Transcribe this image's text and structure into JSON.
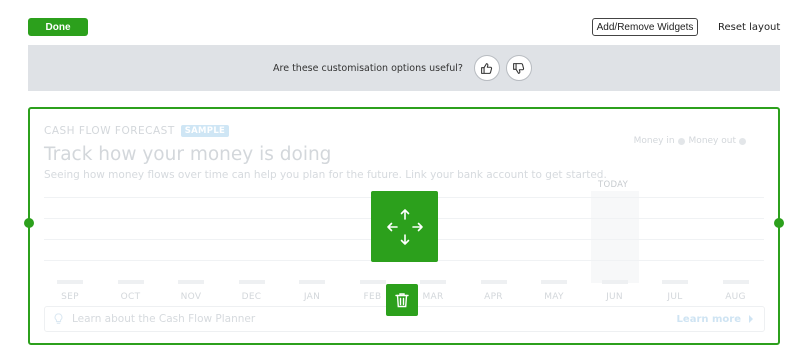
{
  "toolbar": {
    "done_label": "Done",
    "add_remove_label": "Add/Remove Widgets",
    "reset_label": "Reset layout"
  },
  "feedback": {
    "question": "Are these customisation options useful?",
    "thumbs_up_icon": "thumbs-up-icon",
    "thumbs_down_icon": "thumbs-down-icon"
  },
  "widget": {
    "title": "CASH FLOW FORECAST",
    "badge": "SAMPLE",
    "headline": "Track how your money is doing",
    "subtitle": "Seeing how money flows over time can help you plan for the future. Link your bank account to get started.",
    "legend_in": "Money in",
    "legend_out": "Money out",
    "today_label": "TODAY",
    "months": [
      "SEP",
      "OCT",
      "NOV",
      "DEC",
      "JAN",
      "FEB",
      "MAR",
      "APR",
      "MAY",
      "JUN",
      "JUL",
      "AUG"
    ],
    "learn_text": "Learn about the Cash Flow Planner",
    "learn_more": "Learn more"
  },
  "colors": {
    "accent": "#2ca01c",
    "banner_bg": "#dfe2e6"
  },
  "icons": {
    "move": "move-arrows-icon",
    "delete": "trash-icon",
    "bulb": "lightbulb-icon",
    "chevron": "chevron-right-icon"
  }
}
